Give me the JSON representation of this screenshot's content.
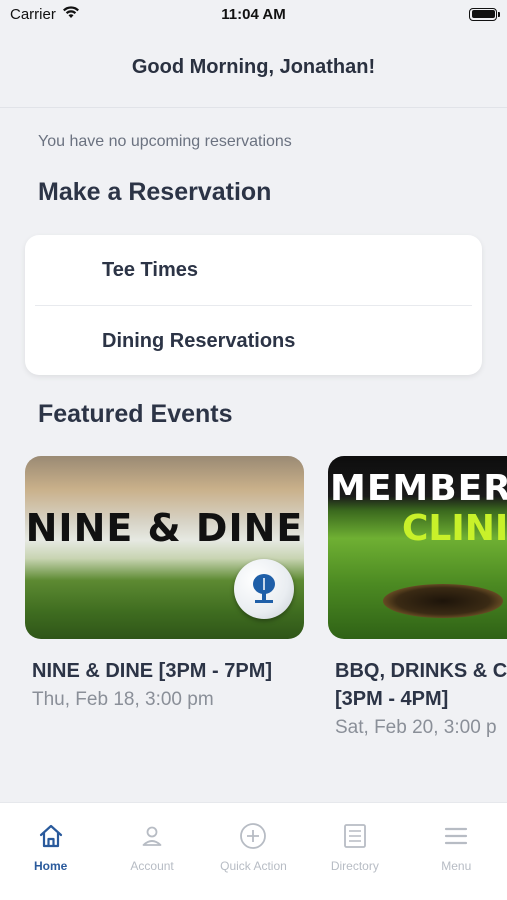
{
  "status_bar": {
    "carrier": "Carrier",
    "time": "11:04 AM"
  },
  "header": {
    "title": "Good Morning, Jonathan!"
  },
  "reservations": {
    "empty_message": "You have no upcoming reservations",
    "section_title": "Make a Reservation",
    "items": [
      {
        "label": "Tee Times"
      },
      {
        "label": "Dining Reservations"
      }
    ]
  },
  "events": {
    "section_title": "Featured Events",
    "items": [
      {
        "image_text": "NINE & DINE",
        "title": "NINE & DINE [3PM - 7PM]",
        "date": "Thu, Feb 18, 3:00 pm"
      },
      {
        "image_text_line1": "MEMBER",
        "image_text_line2": "CLINI",
        "title": "BBQ, DRINKS & C [3PM - 4PM]",
        "date": "Sat, Feb 20, 3:00 p"
      }
    ]
  },
  "tab_bar": {
    "items": [
      {
        "label": "Home",
        "icon": "home-icon",
        "active": true
      },
      {
        "label": "Account",
        "icon": "account-icon"
      },
      {
        "label": "Quick Action",
        "icon": "plus-circle-icon"
      },
      {
        "label": "Directory",
        "icon": "directory-icon"
      },
      {
        "label": "Menu",
        "icon": "menu-icon"
      }
    ]
  },
  "colors": {
    "background": "#f0f1f4",
    "accent": "#2a5a9c",
    "inactive_tab": "#b7bcc4",
    "text_primary": "#2c3446",
    "text_secondary": "#8a8f98"
  }
}
